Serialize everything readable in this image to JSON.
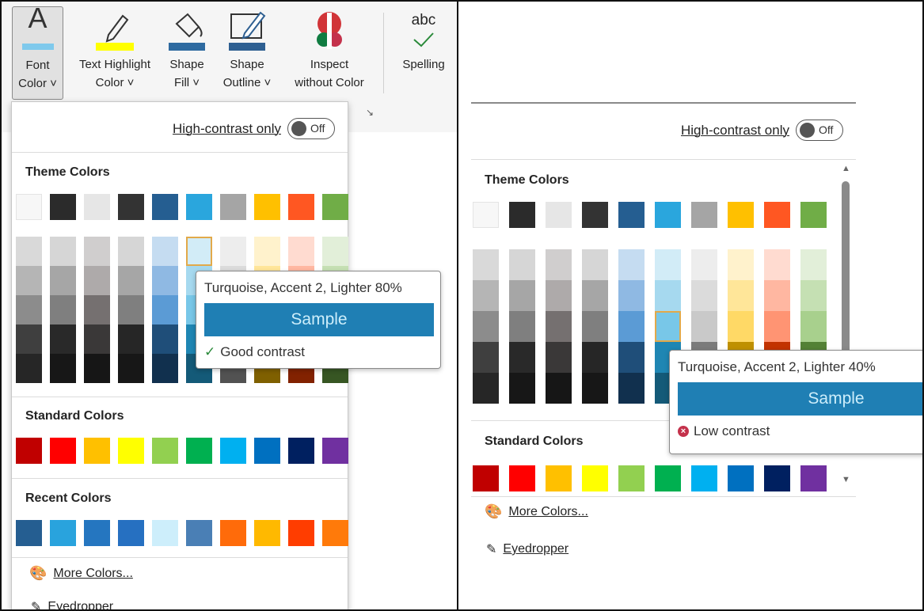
{
  "ribbon": {
    "font_color": {
      "line1": "Font",
      "line2": "Color ˅"
    },
    "text_highlight": {
      "line1": "Text Highlight",
      "line2": "Color ˅"
    },
    "shape_fill": {
      "line1": "Shape",
      "line2": "Fill ˅"
    },
    "shape_outline": {
      "line1": "Shape",
      "line2": "Outline ˅"
    },
    "inspect": {
      "line1": "Inspect",
      "line2": "without Color"
    },
    "spelling": {
      "top": "abc",
      "label": "Spelling"
    },
    "launcher_icon": "dialog-launcher-icon"
  },
  "left_panel": {
    "high_contrast_label": "High-contrast only",
    "toggle_state": "Off",
    "theme_title": "Theme Colors",
    "standard_title": "Standard Colors",
    "recent_title": "Recent Colors",
    "more_colors": "More Colors...",
    "eyedropper": "Eyedropper",
    "tooltip": {
      "name": "Turquoise, Accent 2, Lighter 80%",
      "sample": "Sample",
      "result": "Good contrast",
      "result_icon": "check-icon"
    }
  },
  "right_panel": {
    "high_contrast_label": "High-contrast only",
    "toggle_state": "Off",
    "theme_title": "Theme Colors",
    "standard_title": "Standard Colors",
    "more_colors": "More Colors...",
    "eyedropper": "Eyedropper",
    "tooltip": {
      "name": "Turquoise, Accent 2, Lighter 40%",
      "sample": "Sample",
      "result": "Low contrast",
      "result_icon": "error-circle-icon"
    }
  },
  "colors": {
    "theme_base": [
      "#f7f7f7",
      "#2b2b2b",
      "#e6e6e6",
      "#333333",
      "#255e91",
      "#2aa6dd",
      "#a5a5a5",
      "#ffc000",
      "#ff5722",
      "#70ad47"
    ],
    "theme_shades": [
      [
        "#d9d9d9",
        "#b5b5b5",
        "#8c8c8c",
        "#3f3f3f",
        "#262626"
      ],
      [
        "#d6d6d6",
        "#a6a6a6",
        "#7f7f7f",
        "#292929",
        "#171717"
      ],
      [
        "#d0cece",
        "#aeaaaa",
        "#757070",
        "#3a3838",
        "#161616"
      ],
      [
        "#d6d6d6",
        "#a6a6a6",
        "#7f7f7f",
        "#262626",
        "#171717"
      ],
      [
        "#c5dcf1",
        "#8fb9e3",
        "#5b9bd5",
        "#1f4e79",
        "#11304e"
      ],
      [
        "#d2ecf7",
        "#a6d9ef",
        "#78c7e8",
        "#1f86b3",
        "#145a78"
      ],
      [
        "#ededed",
        "#dbdbdb",
        "#c9c9c9",
        "#7b7b7b",
        "#525252"
      ],
      [
        "#fff2cc",
        "#ffe699",
        "#ffd966",
        "#bf9000",
        "#7f6000"
      ],
      [
        "#ffdbd0",
        "#ffb7a1",
        "#ff9473",
        "#c23200",
        "#822200"
      ],
      [
        "#e2efd9",
        "#c5e0b3",
        "#a8d08d",
        "#538135",
        "#375623"
      ]
    ],
    "standard": [
      "#c00000",
      "#ff0000",
      "#ffc000",
      "#ffff00",
      "#92d050",
      "#00b050",
      "#00b0f0",
      "#0070c0",
      "#002060",
      "#7030a0"
    ],
    "recent": [
      "#255e91",
      "#29a3dd",
      "#2576c0",
      "#2670c1",
      "#cdeefb",
      "#4a7fb5",
      "#ff6b0a",
      "#ffb900",
      "#ff3d00",
      "#ff7a0a"
    ],
    "highlight_yellow": "#ffff00",
    "font_color_bar": "#7fc9ec",
    "fill_bar": "#2e6aa0",
    "outline_bar": "#2e5f91",
    "selection_border": "#e2a94a",
    "sample_bg": "#1f7fb4"
  }
}
